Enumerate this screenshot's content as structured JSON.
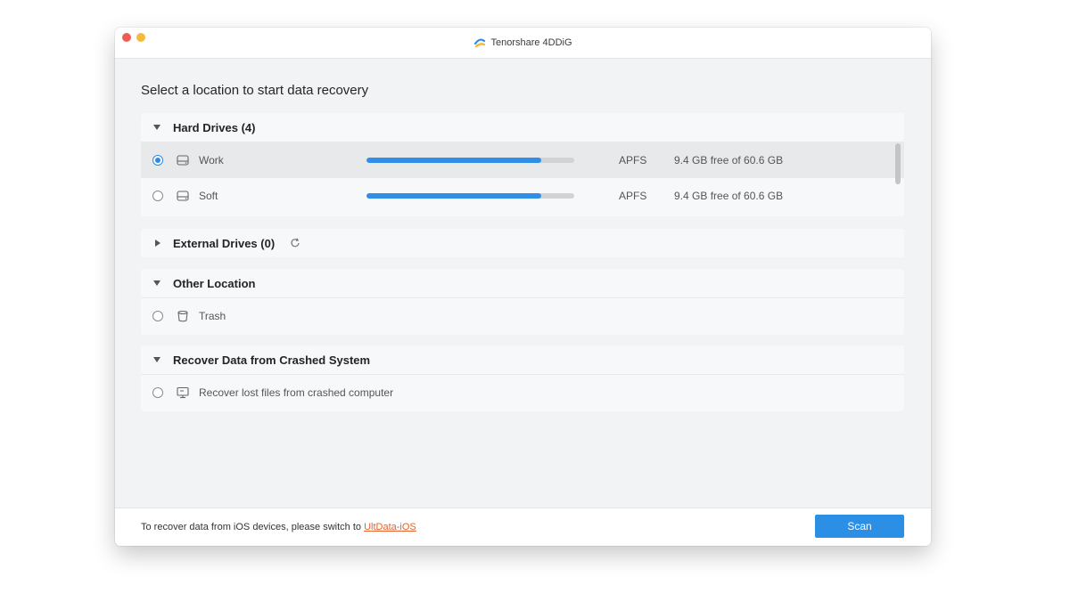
{
  "window": {
    "title": "Tenorshare 4DDiG",
    "logo_icon": "tenorshare-logo-icon"
  },
  "main": {
    "headline": "Select a location to start data recovery"
  },
  "sections": {
    "hard_drives": {
      "title": "Hard Drives (4)",
      "items": [
        {
          "label": "Work",
          "filesystem": "APFS",
          "capacity": "9.4 GB free of 60.6 GB",
          "used_fraction": 0.84,
          "selected": true,
          "icon": "drive-icon"
        },
        {
          "label": "Soft",
          "filesystem": "APFS",
          "capacity": "9.4 GB free of 60.6 GB",
          "used_fraction": 0.84,
          "selected": false,
          "icon": "drive-icon"
        }
      ]
    },
    "external_drives": {
      "title": "External Drives (0)",
      "refresh_icon": "refresh-icon"
    },
    "other_location": {
      "title": "Other Location",
      "items": [
        {
          "label": "Trash",
          "icon": "trash-icon"
        }
      ]
    },
    "crashed_system": {
      "title": "Recover Data from Crashed System",
      "items": [
        {
          "label": "Recover lost files from crashed computer",
          "icon": "monitor-icon"
        }
      ]
    }
  },
  "footer": {
    "text": "To recover data from iOS devices, please switch to ",
    "link": "UltData-iOS",
    "scan_label": "Scan"
  },
  "colors": {
    "accent": "#2b8fe6",
    "link": "#e8612c",
    "bar_track": "#d1d3d7"
  }
}
